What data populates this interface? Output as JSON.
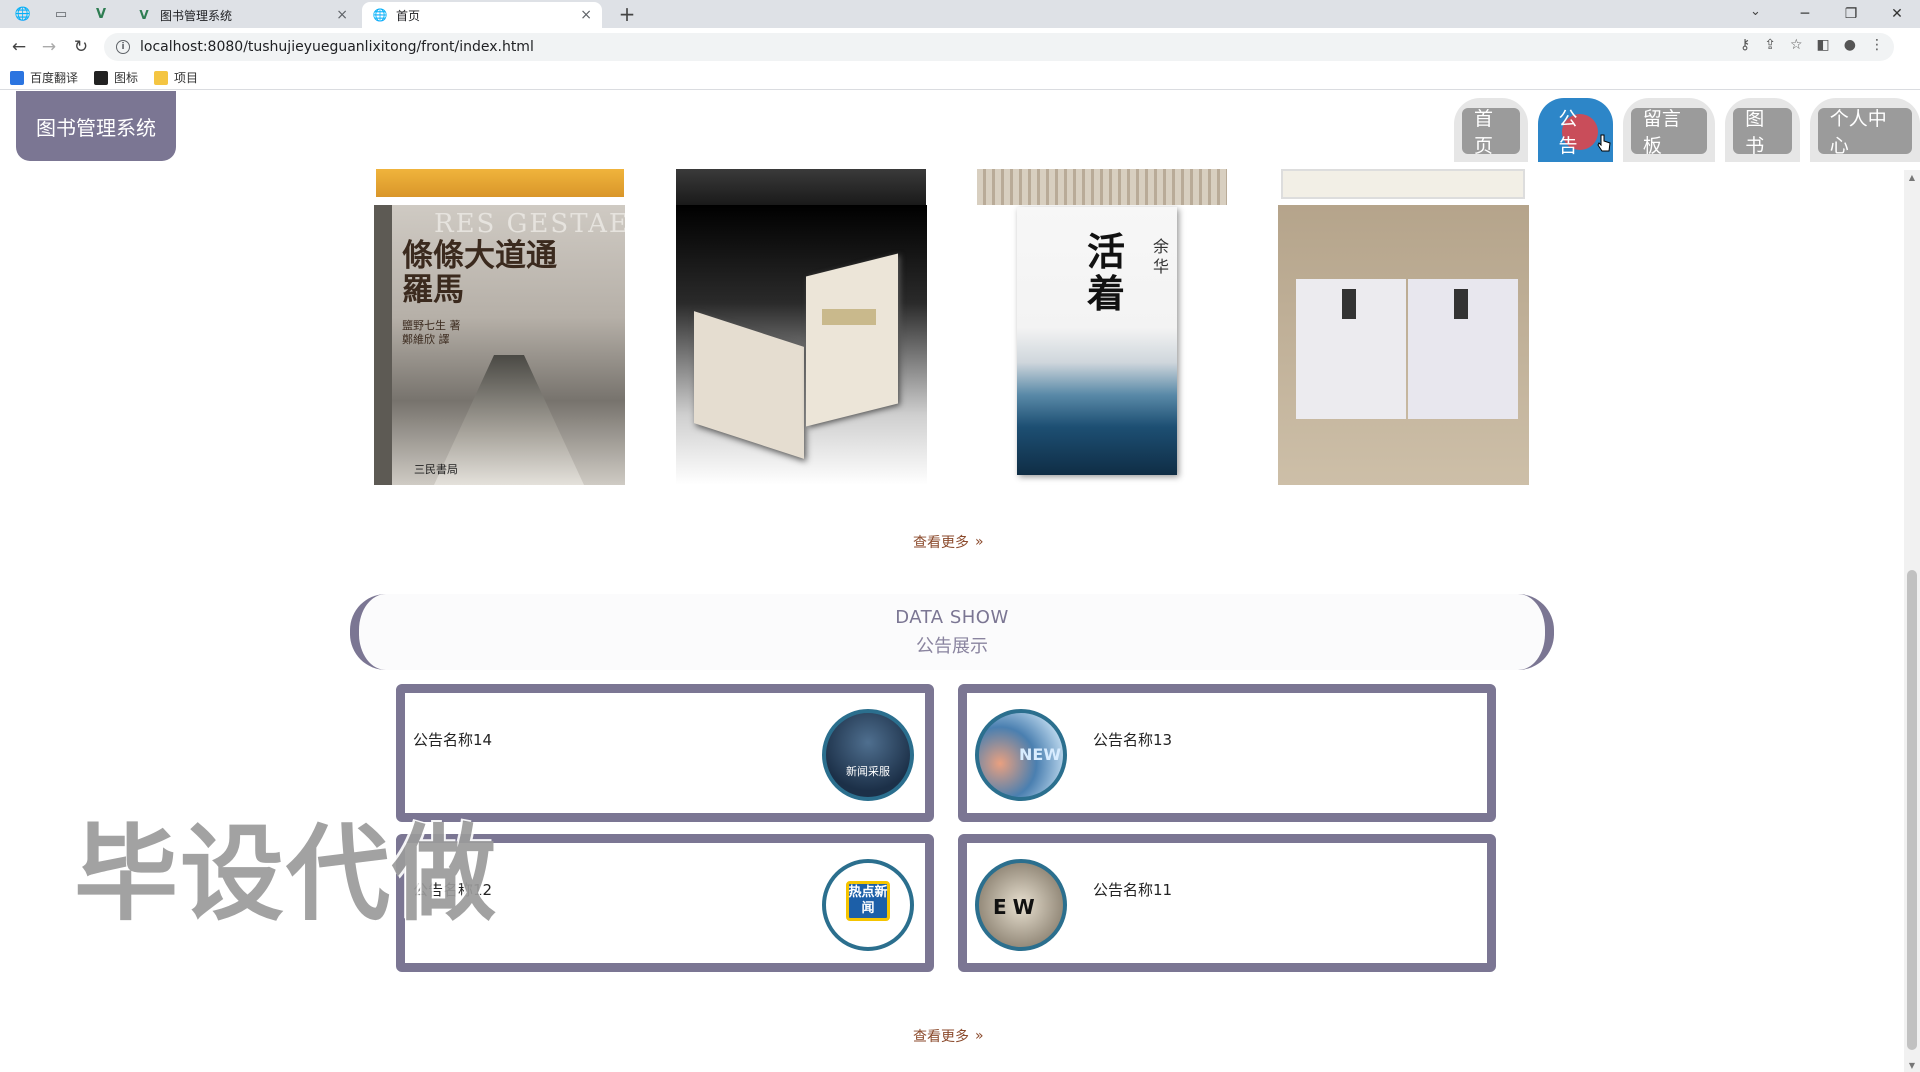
{
  "browser": {
    "tabs": [
      {
        "title": "图书管理系统",
        "close": "×"
      },
      {
        "title": "首页",
        "close": "×"
      }
    ],
    "new_tab": "+",
    "url": "localhost:8080/tushujieyueguanlixitong/front/index.html",
    "bookmarks": [
      {
        "label": "百度翻译",
        "icon": "translate-icon"
      },
      {
        "label": "图标",
        "icon": "picture-icon"
      },
      {
        "label": "项目",
        "icon": "folder-icon"
      }
    ]
  },
  "header": {
    "logo": "图书管理系统",
    "nav": [
      {
        "label": "首页"
      },
      {
        "label": "公告",
        "active": true
      },
      {
        "label": "留言板"
      },
      {
        "label": "图书"
      },
      {
        "label": "个人中心"
      }
    ]
  },
  "books": {
    "cover1_title": "條條大道通羅馬",
    "cover1_author": "鹽野七生 著",
    "cover1_translator": "鄭維欣 譯",
    "cover1_overlay": "RES GESTAE POPULI ROMANI",
    "cover1_publisher": "三民書局",
    "cover3_title": "活着",
    "cover3_author": "余华",
    "more_label": "查看更多"
  },
  "notices": {
    "section_en": "DATA SHOW",
    "section_zh": "公告展示",
    "items": [
      {
        "title": "公告名称14",
        "thumb_text": "新闻采服"
      },
      {
        "title": "公告名称13",
        "thumb_text": "NEW"
      },
      {
        "title": "公告名称12",
        "thumb_text": "热点新闻"
      },
      {
        "title": "公告名称11",
        "thumb_text": "EW"
      }
    ],
    "more_label": "查看更多"
  },
  "watermark": "毕设代做"
}
